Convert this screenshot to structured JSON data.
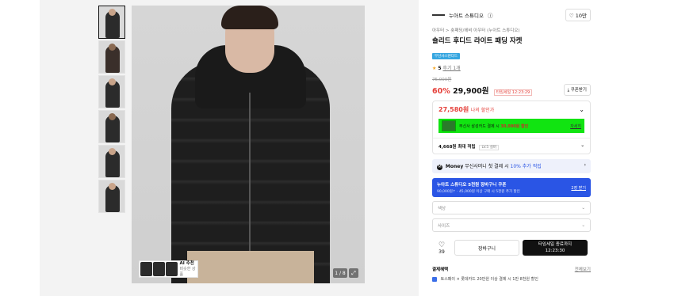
{
  "gallery": {
    "thumbnails": [
      {
        "label": "thumb-1",
        "active": true
      },
      {
        "label": "thumb-2",
        "active": false
      },
      {
        "label": "thumb-3",
        "active": false
      },
      {
        "label": "thumb-4",
        "active": false
      },
      {
        "label": "thumb-5",
        "active": false
      },
      {
        "label": "thumb-6",
        "active": false
      }
    ],
    "ai_title": "AI 추천",
    "ai_sub": "비슷한 상품",
    "pager": "1 / 8",
    "expand_icon": "expand-icon"
  },
  "product": {
    "brand": "누아트 스튜디오",
    "likes": "10만",
    "breadcrumb": "아우터 > 숏패딩/헤비 아우터 (누아트 스튜디오)",
    "title": "숄리드 후디드 라이트 패딩 자켓",
    "badge": "무신사스탠다드",
    "rating": "5",
    "review_label": "후기 1개",
    "original_price": "75,000원",
    "discount": "60%",
    "price": "29,900원",
    "timer_label": "타임세일 12:23:29",
    "coupon_label": "쿠폰받기"
  },
  "lowest": {
    "price": "27,580원",
    "label": "나의 할인가",
    "card_text": "무신사 삼성카드 결제 시",
    "card_amount": "30,000원 할인",
    "card_link": "자세히",
    "points": "4,668원 최대 적립",
    "points_tag": "LV.5 실버"
  },
  "money": {
    "label": "Money",
    "text": "무신사머니 첫 결제 시",
    "highlight": "10% 추가 적립"
  },
  "brand_coupon": {
    "title": "누아트 스튜디오 5천원 장바구니 쿠폰",
    "sub": "90,000원↑ · 45,000원 이상 구매 시 5천원 추가 할인",
    "download": "2장 받기"
  },
  "options": {
    "color": "색상",
    "size": "사이즈"
  },
  "actions": {
    "like_count": "39",
    "cart": "장바구니",
    "buy_line1": "타임세일 종료까지",
    "buy_line2": "12:23:30"
  },
  "benefits": {
    "title": "결제혜택",
    "more": "전체보기",
    "item": "토스페이 × 롯데카드 20만원 이상 결제 시 1만 8천원 할인"
  },
  "colors": {
    "accent_red": "#e5413b",
    "blue": "#2a55e5",
    "highlight_green": "#11e411"
  }
}
